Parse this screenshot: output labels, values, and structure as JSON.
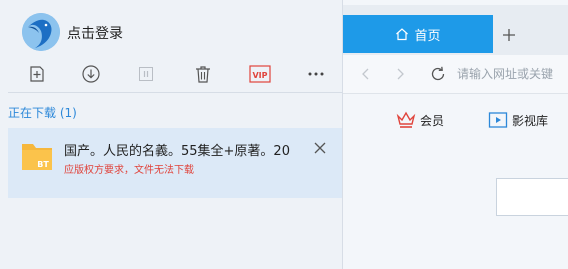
{
  "account": {
    "login_label": "点击登录"
  },
  "toolbar": {
    "new_icon": "add-task-icon",
    "download_icon": "download-icon",
    "pause_icon": "pause-icon",
    "delete_icon": "trash-icon",
    "vip_label": "VIP",
    "more_icon": "more-icon"
  },
  "downloads": {
    "section_label": "正在下载 (1)",
    "items": [
      {
        "badge": "BT",
        "title": "国产。人民的名義。55集全+原著。20",
        "status": "应版权方要求，文件无法下载"
      }
    ]
  },
  "browser": {
    "tabs": [
      {
        "label": "首页",
        "active": true
      }
    ],
    "add_tab_icon": "plus-icon",
    "url_placeholder": "请输入网址或关键",
    "links": [
      {
        "label": "会员",
        "icon": "crown-icon"
      },
      {
        "label": "影视库",
        "icon": "video-library-icon"
      }
    ]
  },
  "colors": {
    "accent": "#1e9ae8",
    "link_blue": "#2c88d9",
    "error_red": "#e0443c",
    "selected_row": "#dce9f7"
  }
}
